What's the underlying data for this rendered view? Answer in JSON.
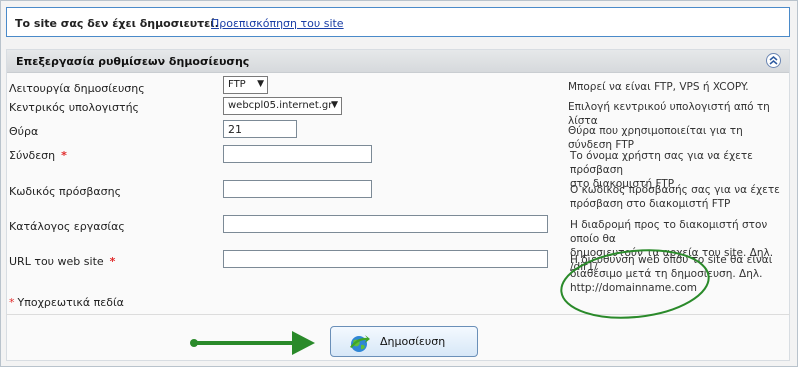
{
  "notice": {
    "message": "Το site σας δεν έχει δημοσιευτεί.",
    "preview_link": "Προεπισκόπηση του site"
  },
  "panel": {
    "title": "Επεξεργασία ρυθμίσεων δημοσίευσης"
  },
  "form": {
    "mode": {
      "label": "Λειτουργία δημοσίευσης",
      "value": "FTP",
      "hint": "Μπορεί να είναι FTP, VPS ή XCOPY."
    },
    "host": {
      "label": "Κεντρικός υπολογιστής",
      "value": "webcpl05.internet.gr",
      "hint": "Επιλογή κεντρικού υπολογιστή από τη λίστα"
    },
    "port": {
      "label": "Θύρα",
      "value": "21",
      "hint": "Θύρα που χρησιμοποιείται για τη σύνδεση FTP"
    },
    "login": {
      "label": "Σύνδεση",
      "required_mark": "*",
      "value": "",
      "hint_line1": "Το όνομα χρήστη σας για να έχετε πρόσβαση",
      "hint_line2": "στο διακομιστή FTP"
    },
    "password": {
      "label": "Κωδικός πρόσβασης",
      "value": "",
      "hint_line1": "Ο κωδικός πρόσβασής σας για να έχετε",
      "hint_line2": "πρόσβαση στο διακομιστή FTP"
    },
    "directory": {
      "label": "Κατάλογος εργασίας",
      "value": "",
      "hint_line1": "Η διαδρομή προς το διακομιστή στον οποίο θα",
      "hint_line2": "δημοσιευτούν τα αρχεία του site. Δηλ. /dir1/"
    },
    "url": {
      "label": "URL του web site",
      "required_mark": "*",
      "value": "",
      "hint_line1": "Η διεύθυνση web όπου το site θα είναι",
      "hint_line2": "διαθέσιμο μετά τη δημοσίευση. Δηλ.",
      "hint_line3": "http://domainname.com"
    },
    "required_note_star": "*",
    "required_note": "Υποχρεωτικά πεδία"
  },
  "publish_button": {
    "label": "Δημοσίευση",
    "icon": "globe-arrow-icon"
  },
  "colors": {
    "link": "#1a3ea6",
    "required": "#e12b2b",
    "annotation": "#2a8a2a",
    "notice_border": "#4a8ac9"
  }
}
